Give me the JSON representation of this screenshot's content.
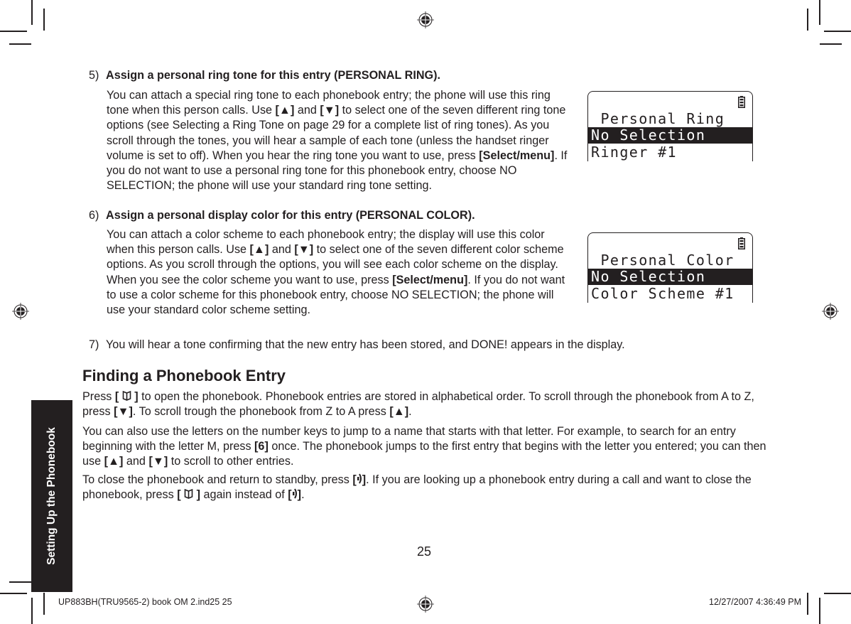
{
  "side_tab": {
    "label": "Setting Up the Phonebook"
  },
  "steps": [
    {
      "number": "5)",
      "heading": "Assign a personal ring tone for this entry (PERSONAL RING).",
      "paragraph": {
        "t1": "You can attach a special ring tone to each phonebook entry; the phone will use this ring tone when this person calls. Use ",
        "up_key": "[▲]",
        "t2": " and ",
        "down_key": "[▼]",
        "t3": " to select one of the seven different ring tone options (see Selecting a Ring Tone on page 29 for a complete list of ring tones). As you scroll through the tones, you will hear a sample of each tone (unless the handset ringer volume is set to off). When you hear the ring tone you want to use, press ",
        "select_key": "[Select/menu]",
        "t4": ". If you do not want to use a personal ring tone for this phonebook entry, choose NO SELECTION; the phone will use your standard ring tone setting."
      }
    },
    {
      "number": "6)",
      "heading": "Assign a personal display color for this entry (PERSONAL COLOR).",
      "paragraph": {
        "t1": "You can attach a color scheme to each phonebook entry; the display will use this color when this person calls. Use ",
        "up_key": "[▲]",
        "t2": " and ",
        "down_key": "[▼]",
        "t3": " to select one of the seven different color scheme options. As you scroll through the options, you will see each color scheme on the display. When you see the color scheme you want to use, press ",
        "select_key": "[Select/menu]",
        "t4": ". If you do not want to use a color scheme for this phonebook entry, choose NO SELECTION; the phone will use your standard color scheme setting."
      }
    },
    {
      "number": "7)",
      "text": "You will hear a tone confirming that the new entry has been stored, and DONE! appears in the display."
    }
  ],
  "lcd_screens": [
    {
      "icon": "battery-icon",
      "title": " Personal Ring",
      "selected": "No Selection  ",
      "option": "Ringer #1"
    },
    {
      "icon": "battery-icon",
      "title": " Personal Color",
      "selected": "No Selection  ",
      "option": "Color Scheme #1"
    }
  ],
  "section": {
    "title": "Finding a Phonebook Entry",
    "p1": {
      "t1": "Press ",
      "pb_key_open": "[ ",
      "pb_key_close": " ]",
      "t2": " to open the phonebook. Phonebook entries are stored in alphabetical order. To scroll through the phonebook from A to Z, press ",
      "down_key": "[▼]",
      "t3": ". To scroll trough the phonebook from Z to A press ",
      "up_key": "[▲]",
      "t4": "."
    },
    "p2": {
      "t1": "You can also use the letters on the number keys to jump to a name that starts with that letter. For example, to search for an entry beginning with the letter M, press ",
      "key6": "[6]",
      "t2": " once. The phonebook jumps to the first entry that begins with the letter you entered; you can then use ",
      "up_key": "[▲]",
      "t3": " and ",
      "down_key": "[▼]",
      "t4": " to scroll to other entries."
    },
    "p3": {
      "t1": "To close the phonebook and return to standby, press ",
      "end_open": "[",
      "end_close": "]",
      "t2": ". If you are looking up a phonebook entry during a call and want to close the phonebook, press ",
      "pb_key_open": "[ ",
      "pb_key_close": " ]",
      "t3": " again instead of ",
      "t4": "."
    }
  },
  "page_number": "25",
  "footer": {
    "left": "UP883BH(TRU9565-2) book OM 2.ind25   25",
    "right": "12/27/2007   4:36:49 PM"
  }
}
